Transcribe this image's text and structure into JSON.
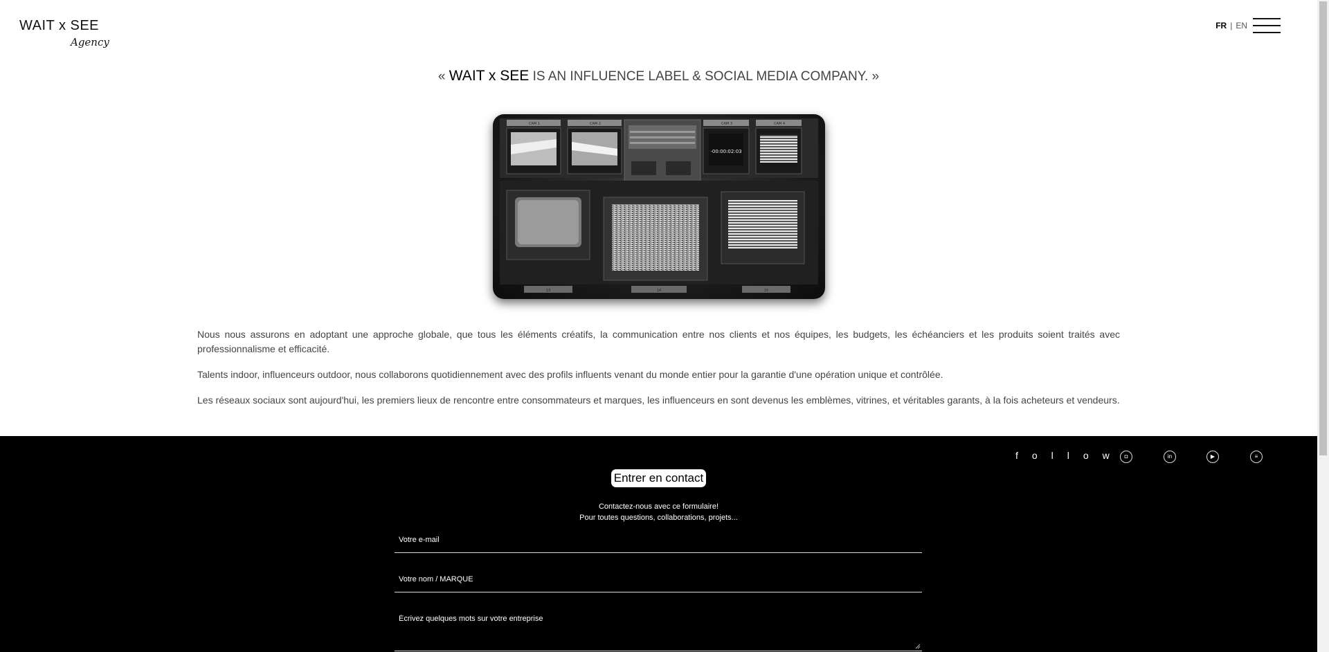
{
  "header": {
    "logo_main": "WAIT x SEE",
    "logo_sub": "Agency",
    "lang_fr": "FR",
    "lang_sep": "|",
    "lang_en": "EN"
  },
  "tagline": {
    "open_quote": "« ",
    "brand": "WAIT x SEE",
    "rest": " IS AN INFLUENCE LABEL & SOCIAL MEDIA COMPANY. »"
  },
  "hero": {
    "timer": "-00:00:02:03",
    "labels": [
      "CAM 1",
      "CAM 2",
      "CAM 3",
      "CAM 4",
      "13",
      "14",
      "15"
    ]
  },
  "paragraphs": [
    "Nous nous assurons en adoptant une approche globale, que tous les éléments créatifs, la communication entre nos clients et nos équipes, les budgets, les échéanciers et les produits soient traités avec professionnalisme et efficacité.",
    "Talents indoor, influenceurs outdoor, nous collaborons quotidiennement avec des profils influents venant du monde entier pour la garantie d'une opération unique et contrôlée.",
    "Les réseaux sociaux sont aujourd'hui, les premiers lieux de rencontre entre consommateurs et marques, les influenceurs en sont devenus les emblèmes, vitrines, et véritables garants, à la fois acheteurs et vendeurs."
  ],
  "footer": {
    "follow": "follow",
    "social": [
      {
        "icon": "instagram-icon",
        "glyph": "◘"
      },
      {
        "icon": "linkedin-icon",
        "glyph": "in"
      },
      {
        "icon": "youtube-icon",
        "glyph": "▶"
      },
      {
        "icon": "spotify-icon",
        "glyph": "≡"
      }
    ],
    "contact_title": "Entrer en contact",
    "contact_line1": "Contactez-nous avec ce formulaire!",
    "contact_line2": "Pour toutes questions, collaborations, projets...",
    "email_placeholder": "Votre e-mail",
    "name_placeholder": "Votre nom / MARQUE",
    "message_placeholder": "Écrivez quelques mots sur votre entreprise"
  }
}
